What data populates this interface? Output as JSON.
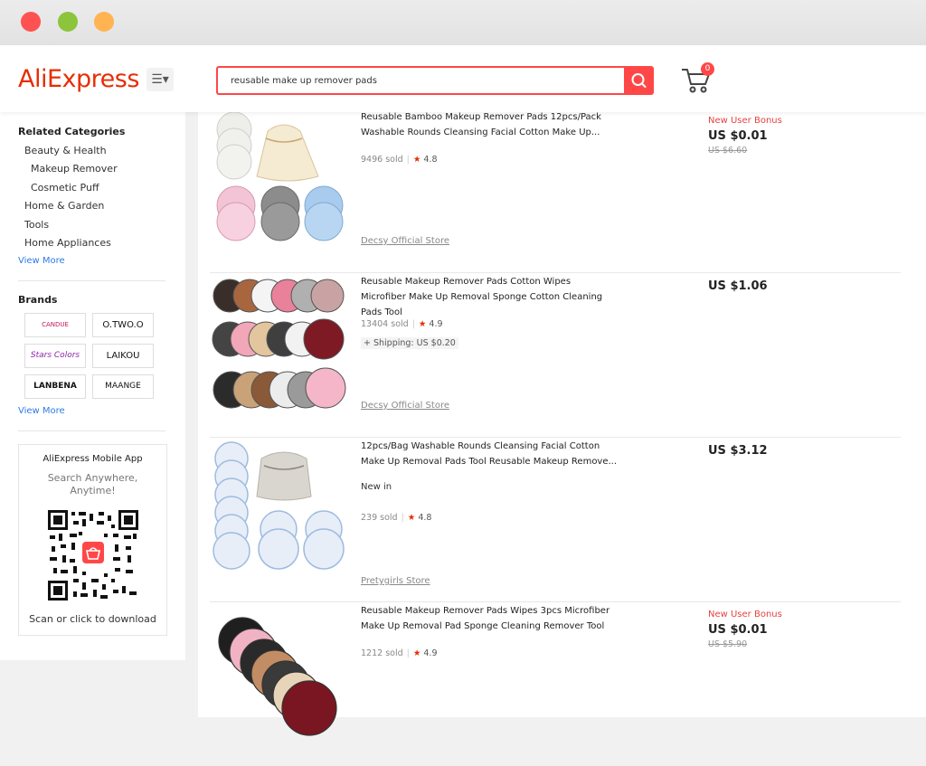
{
  "window": {
    "controls": [
      "close",
      "minimize",
      "maximize"
    ]
  },
  "header": {
    "logo": "AliExpress",
    "category_icon": "menu-icon",
    "search": {
      "value": "reusable make up remover pads"
    },
    "cart": {
      "count": "0"
    }
  },
  "sidebar": {
    "related_title": "Related Categories",
    "categories": [
      "Beauty & Health",
      "Makeup Remover",
      "Cosmetic Puff",
      "Home & Garden",
      "Tools",
      "Home Appliances"
    ],
    "view_more_1": "View More",
    "brands_title": "Brands",
    "brands": [
      "CANDUE",
      "O.TWO.O",
      "Stars Colors",
      "LAIKOU",
      "LANBENA",
      "MAANGE"
    ],
    "view_more_2": "View More",
    "app": {
      "title": "AliExpress Mobile App",
      "subtitle": "Search Anywhere, Anytime!",
      "cta": "Scan or click to download"
    }
  },
  "products": [
    {
      "title": "Reusable Bamboo Makeup Remover Pads 12pcs/Pack Washable Rounds Cleansing Facial Cotton Make Up...",
      "sold": "9496 sold",
      "rating": "4.8",
      "store": "Decsy Official Store",
      "bonus": "New User Bonus",
      "price": "US $0.01",
      "original": "US $6.60"
    },
    {
      "title": "Reusable Makeup Remover Pads Cotton Wipes Microfiber Make Up Removal Sponge Cotton Cleaning Pads Tool",
      "sold": "13404 sold",
      "rating": "4.9",
      "shipping": "+ Shipping: US $0.20",
      "store": "Decsy Official Store",
      "price": "US $1.06"
    },
    {
      "title": "12pcs/Bag Washable Rounds Cleansing Facial Cotton Make Up Removal Pads Tool Reusable Makeup Remove...",
      "tag": "New in",
      "sold": "239 sold",
      "rating": "4.8",
      "store": "Pretygirls Store",
      "price": "US $3.12"
    },
    {
      "title": "Reusable Makeup Remover Pads Wipes 3pcs Microfiber Make Up Removal Pad Sponge Cleaning Remover Tool",
      "sold": "1212 sold",
      "rating": "4.9",
      "bonus": "New User Bonus",
      "price": "US $0.01",
      "original": "US $5.90"
    }
  ],
  "colors": {
    "accent": "#ff4747",
    "brand": "#e62e04",
    "link": "#2c7be5"
  }
}
